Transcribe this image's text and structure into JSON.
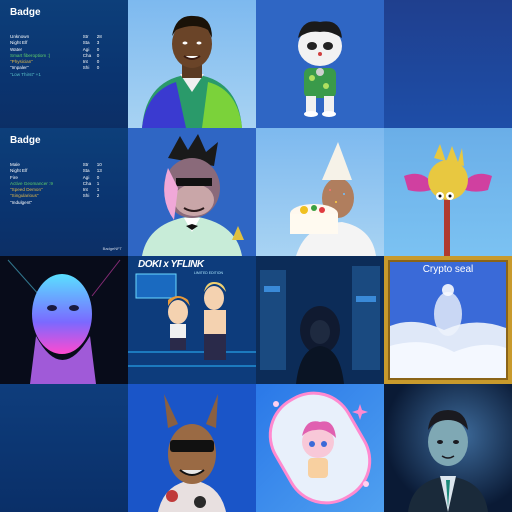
{
  "cards": [
    {
      "title": "Badge",
      "traits": [
        {
          "text": "Unknown",
          "color": "w"
        },
        {
          "text": "Night Elf",
          "color": "w"
        },
        {
          "text": "Water",
          "color": "w"
        },
        {
          "text": "Smart fiberoptiom :)",
          "color": "g"
        },
        {
          "text": "\"Physician\"",
          "color": "y"
        },
        {
          "text": "\"Impaler\"",
          "color": "w"
        },
        {
          "text": "\"Low Thirst\" +1",
          "color": "c"
        }
      ],
      "stats": [
        {
          "k": "Str",
          "v": "28"
        },
        {
          "k": "Sta",
          "v": "3"
        },
        {
          "k": "Agi",
          "v": "0"
        },
        {
          "k": "Cha",
          "v": "0"
        },
        {
          "k": "Int",
          "v": "0"
        },
        {
          "k": "Shi",
          "v": "0"
        }
      ]
    },
    {
      "title": "Badge",
      "traits": [
        {
          "text": "Male",
          "color": "w"
        },
        {
          "text": "Night Elf",
          "color": "w"
        },
        {
          "text": "Fire",
          "color": "w"
        },
        {
          "text": "Active Geomancer :9",
          "color": "g"
        },
        {
          "text": "\"Speed Demon\"",
          "color": "y"
        },
        {
          "text": "\"Singularious\"",
          "color": "y"
        },
        {
          "text": "\"Indulgent\"",
          "color": "w"
        }
      ],
      "stats": [
        {
          "k": "Str",
          "v": "10"
        },
        {
          "k": "Sta",
          "v": "13"
        },
        {
          "k": "Agi",
          "v": "0"
        },
        {
          "k": "Cha",
          "v": "1"
        },
        {
          "k": "Int",
          "v": "1"
        },
        {
          "k": "Shi",
          "v": "2"
        }
      ]
    }
  ],
  "maker_label": "BadgeNFT",
  "thumbs": {
    "doki_title": "DOKI x YFLINK",
    "doki_sub": "LIMITED EDITION",
    "crypto_seal": "Crypto seal"
  }
}
